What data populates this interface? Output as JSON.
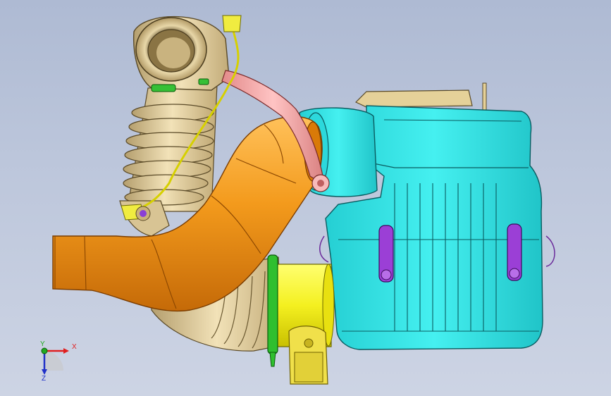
{
  "view": {
    "title": "",
    "background_top": "#aebad3",
    "background_bottom": "#cdd4e4"
  },
  "parts": [
    {
      "name": "air-intake-duct",
      "color": "#f39a1c"
    },
    {
      "name": "corrugated-intake-hose",
      "color": "#e3cfa0"
    },
    {
      "name": "air-filter-housing-lower",
      "color": "#36e6e6"
    },
    {
      "name": "air-filter-housing-cover-top",
      "color": "#e5d199"
    },
    {
      "name": "breather-tube",
      "color": "#f2a8a8"
    },
    {
      "name": "throttle-body-adapter",
      "color": "#fafa20"
    },
    {
      "name": "hose-clamp",
      "color": "#2fbf2f"
    },
    {
      "name": "sensor-connector",
      "color": "#f0e04a"
    },
    {
      "name": "housing-latch-clip",
      "color": "#9b3fd6"
    },
    {
      "name": "wiring-harness",
      "color": "#e6e626"
    }
  ],
  "triad": {
    "x_label": "X",
    "y_label": "Y",
    "z_label": "Z",
    "x_color": "#e02020",
    "y_color": "#22aa22",
    "z_color": "#2030c8"
  }
}
